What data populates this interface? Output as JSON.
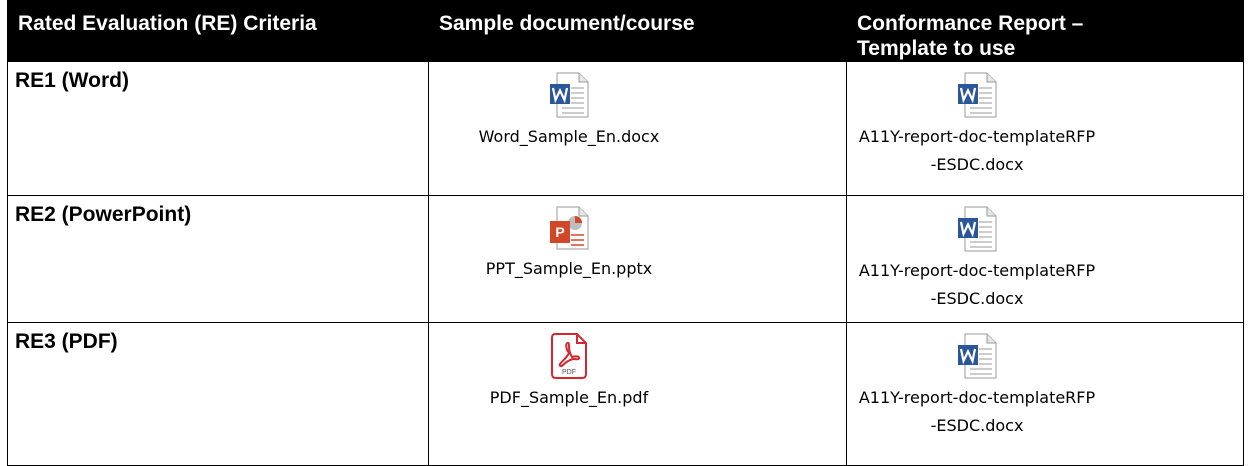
{
  "headers": [
    "Rated Evaluation (RE) Criteria",
    "Sample document/course",
    "Conformance Report – Template to use"
  ],
  "rows": [
    {
      "criteria": "RE1 (Word)",
      "sample": {
        "icon": "word-document-icon",
        "filename": "Word_Sample_En.docx"
      },
      "template": {
        "icon": "word-document-icon",
        "filename": "A11Y-report-doc-templateRFP-ESDC.docx"
      }
    },
    {
      "criteria": "RE2 (PowerPoint)",
      "sample": {
        "icon": "powerpoint-document-icon",
        "filename": "PPT_Sample_En.pptx"
      },
      "template": {
        "icon": "word-document-icon",
        "filename": "A11Y-report-doc-templateRFP-ESDC.docx"
      }
    },
    {
      "criteria": "RE3 (PDF)",
      "sample": {
        "icon": "pdf-document-icon",
        "filename": "PDF_Sample_En.pdf"
      },
      "template": {
        "icon": "word-document-icon",
        "filename": "A11Y-report-doc-templateRFP-ESDC.docx"
      }
    }
  ],
  "colors": {
    "header_bg": "#000000",
    "header_text": "#ffffff",
    "word_blue": "#2b579a",
    "powerpoint_orange": "#d24726",
    "pdf_red": "#d9262e"
  }
}
